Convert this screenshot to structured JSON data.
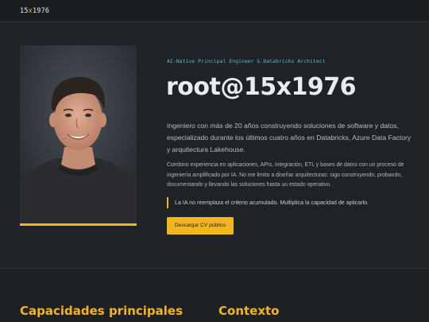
{
  "header": {
    "brand_prefix": "15",
    "brand_x": "x",
    "brand_suffix": "1976"
  },
  "hero": {
    "eyebrow": "AI-Native Principal Engineer & Databricks Architect",
    "title": "root@15x1976",
    "lead": "Ingeniero con más de 20 años construyendo soluciones de software y datos, especializado durante los últimos cuatro años en Databricks, Azure Data Factory y arquitectura Lakehouse.",
    "detail": "Combino experiencia en aplicaciones, APIs, integración, ETL y bases de datos con un proceso de ingeniería amplificado por IA. No me limito a diseñar arquitecturas: sigo construyendo, probando, documentando y llevando las soluciones hasta un estado operativo.",
    "quote": "La IA no reemplaza el criterio acumulado. Multiplica la capacidad de aplicarlo.",
    "cta_label": "Descargar CV público"
  },
  "sections": {
    "capabilities_title": "Capacidades principales",
    "context_title": "Contexto"
  },
  "colors": {
    "accent": "#f2b51d",
    "eyebrow": "#5fb7c6",
    "background": "#1e2124"
  }
}
